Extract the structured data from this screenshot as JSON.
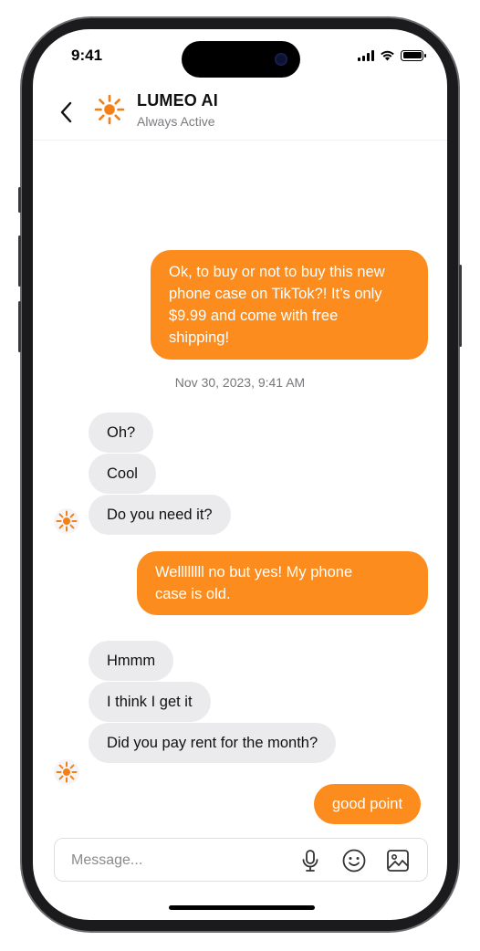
{
  "status_bar": {
    "time": "9:41"
  },
  "header": {
    "title": "LUMEO AI",
    "subtitle": "Always Active"
  },
  "messages": {
    "m1": "Ok, to buy or not to buy this new\nphone case on TikTok?! It’s only\n$9.99 and come with free\nshipping!",
    "timestamp": "Nov 30, 2023, 9:41 AM",
    "m2": "Oh?",
    "m3": "Cool",
    "m4": "Do you need it?",
    "m5": "Wellllllll no but yes! My phone\ncase is old.",
    "m6": "Hmmm",
    "m7": "I think I get it",
    "m8": "Did you pay rent for the month?",
    "m9": "good point"
  },
  "composer": {
    "placeholder": "Message..."
  },
  "icons": {
    "back": "chevron-left-icon",
    "avatar": "sun-icon",
    "mic": "microphone-icon",
    "emoji": "smiley-icon",
    "image": "image-icon"
  },
  "colors": {
    "accent": "#fb8c1d",
    "incoming": "#ebebee"
  }
}
